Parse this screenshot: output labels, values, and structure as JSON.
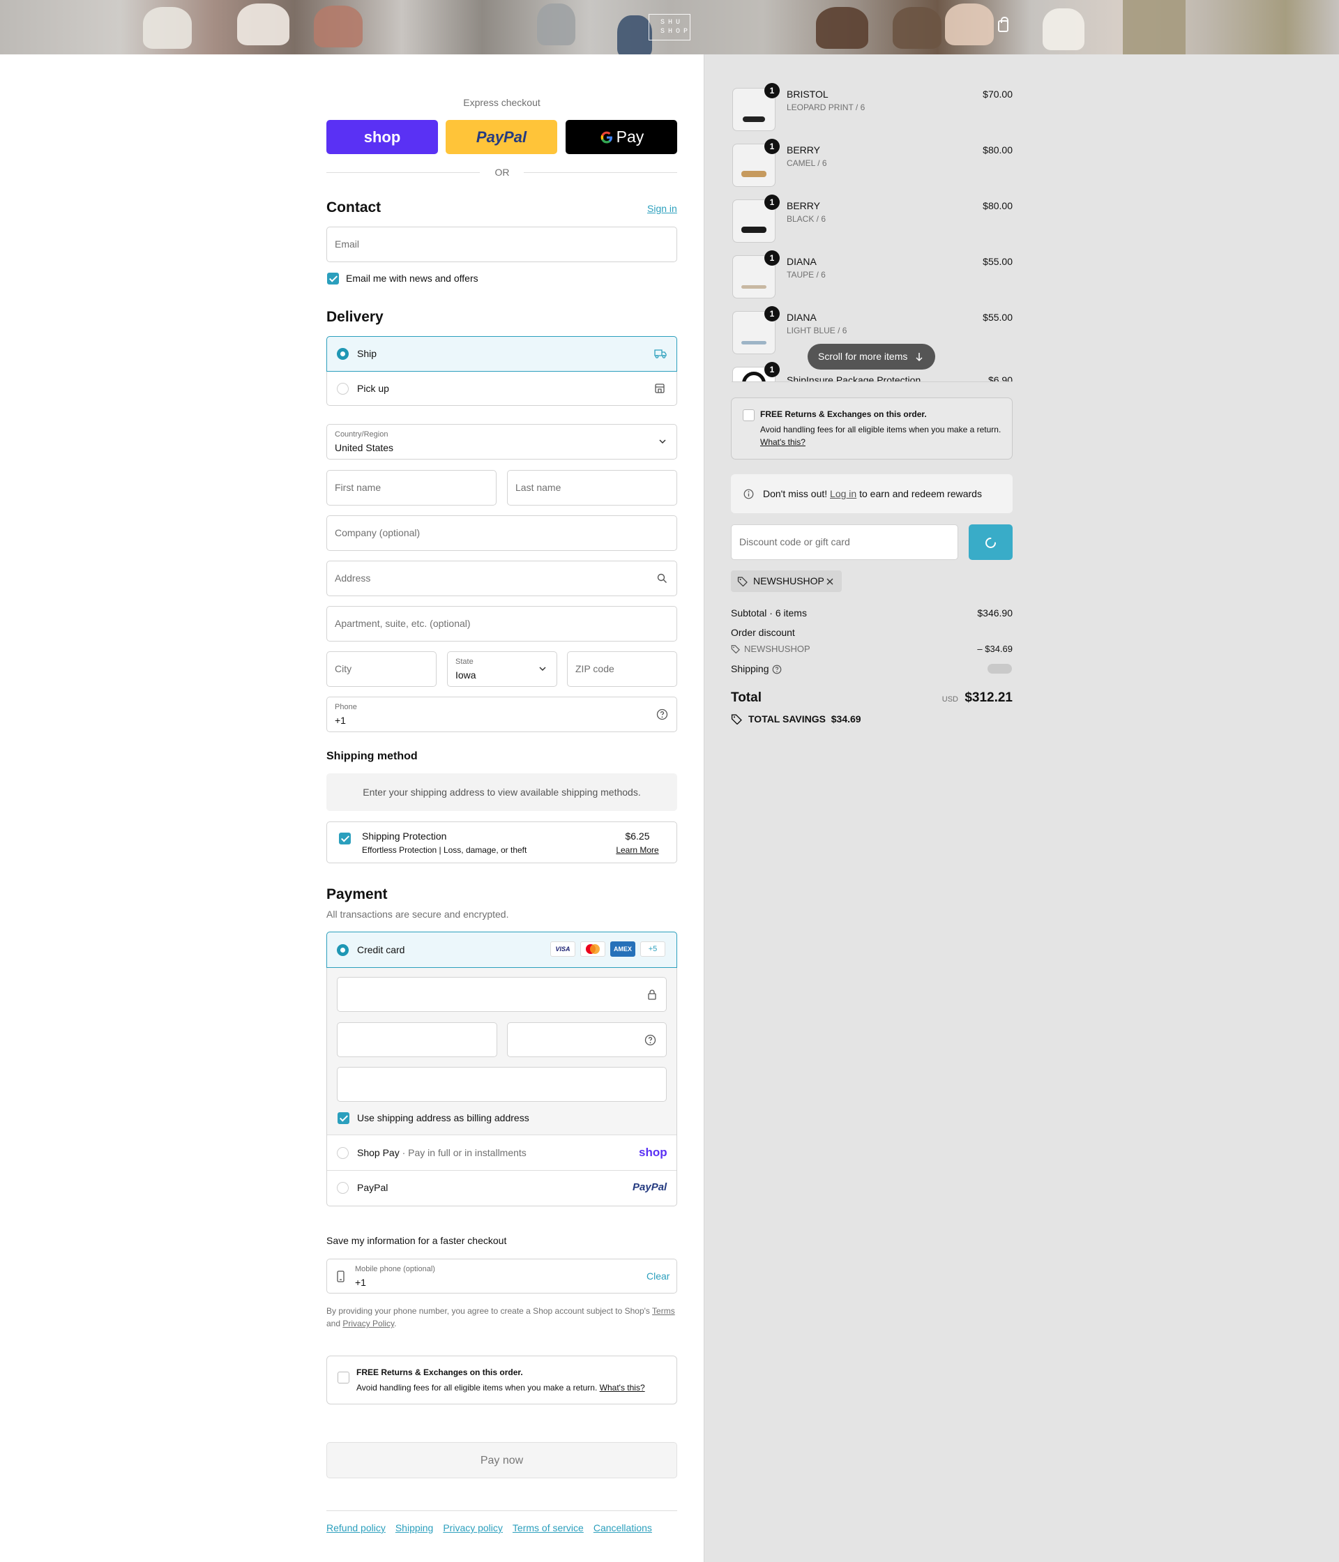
{
  "brand": {
    "logo_line1": "SHU",
    "logo_line2": "SHOP"
  },
  "express": {
    "title": "Express checkout",
    "shop": "shop",
    "paypal": "PayPal",
    "gpay": "Pay",
    "or": "OR"
  },
  "contact": {
    "title": "Contact",
    "sign_in": "Sign in",
    "email_placeholder": "Email",
    "news_label": "Email me with news and offers"
  },
  "delivery": {
    "title": "Delivery",
    "ship": "Ship",
    "pickup": "Pick up",
    "country_label": "Country/Region",
    "country_value": "United States",
    "first_name": "First name",
    "last_name": "Last name",
    "company": "Company (optional)",
    "address": "Address",
    "apartment": "Apartment, suite, etc. (optional)",
    "city": "City",
    "state_label": "State",
    "state_value": "Iowa",
    "zip": "ZIP code",
    "phone_label": "Phone",
    "phone_value": "+1"
  },
  "shipping_method": {
    "title": "Shipping method",
    "note": "Enter your shipping address to view available shipping methods."
  },
  "protection": {
    "title": "Shipping Protection",
    "subtitle": "Effortless Protection | Loss, damage, or theft",
    "price": "$6.25",
    "learn_more": "Learn More"
  },
  "payment": {
    "title": "Payment",
    "subtitle": "All transactions are secure and encrypted.",
    "credit_card": "Credit card",
    "visa": "VISA",
    "amex": "AMEX",
    "more": "+5",
    "billing_same": "Use shipping address as billing address",
    "shop_pay": "Shop Pay",
    "shop_pay_note": "Pay in full or in installments",
    "shop_logo": "shop",
    "paypal": "PayPal",
    "paypal_logo": "PayPal"
  },
  "save_info": {
    "title": "Save my information for a faster checkout",
    "mobile_label": "Mobile phone (optional)",
    "mobile_value": "+1",
    "clear": "Clear",
    "legal_pre": "By providing your phone number, you agree to create a Shop account subject to Shop's ",
    "terms": "Terms",
    "legal_and": "and ",
    "privacy": "Privacy Policy",
    "legal_end": "."
  },
  "returns": {
    "title": "FREE Returns & Exchanges on this order.",
    "body": "Avoid handling fees for all eligible items when you make a return.",
    "whats_this": "What's this?"
  },
  "pay_now": "Pay now",
  "footer": {
    "links": [
      "Refund policy",
      "Shipping",
      "Privacy policy",
      "Terms of service",
      "Cancellations"
    ]
  },
  "cart": {
    "items": [
      {
        "name": "BRISTOL",
        "variant": "LEOPARD PRINT / 6",
        "price": "$70.00",
        "qty": "1"
      },
      {
        "name": "BERRY",
        "variant": "CAMEL / 6",
        "price": "$80.00",
        "qty": "1"
      },
      {
        "name": "BERRY",
        "variant": "BLACK / 6",
        "price": "$80.00",
        "qty": "1"
      },
      {
        "name": "DIANA",
        "variant": "TAUPE / 6",
        "price": "$55.00",
        "qty": "1"
      },
      {
        "name": "DIANA",
        "variant": "LIGHT BLUE / 6",
        "price": "$55.00",
        "qty": "1"
      },
      {
        "name": "ShipInsure Package Protection",
        "variant": "",
        "price": "$6.90",
        "qty": "1"
      }
    ],
    "scroll_hint": "Scroll for more items",
    "rewards_pre": "Don't miss out! ",
    "rewards_link": "Log in",
    "rewards_post": " to earn and redeem rewards",
    "discount_placeholder": "Discount code or gift card",
    "applied_code": "NEWSHUSHOP",
    "subtotal_label": "Subtotal · 6 items",
    "subtotal": "$346.90",
    "order_discount": "Order discount",
    "discount_code": "NEWSHUSHOP",
    "discount_amount": "– $34.69",
    "shipping_label": "Shipping",
    "total_label": "Total",
    "currency": "USD",
    "total": "$312.21",
    "savings_label": "TOTAL SAVINGS",
    "savings": "$34.69"
  }
}
